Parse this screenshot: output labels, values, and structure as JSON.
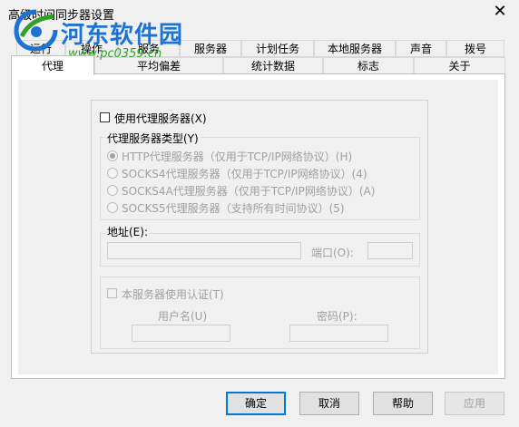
{
  "window": {
    "title": "高级时间同步器设置",
    "close_label": "✕"
  },
  "watermark": {
    "name": "河东软件园",
    "url": "www.pc0359.cn"
  },
  "tabs_row1": [
    {
      "label": "运行"
    },
    {
      "label": "操作"
    },
    {
      "label": "服务"
    },
    {
      "label": "服务器"
    },
    {
      "label": "计划任务"
    },
    {
      "label": "本地服务器"
    },
    {
      "label": "声音"
    },
    {
      "label": "拨号"
    }
  ],
  "tabs_row2": [
    {
      "label": "代理"
    },
    {
      "label": "平均偏差"
    },
    {
      "label": "统计数据"
    },
    {
      "label": "标志"
    },
    {
      "label": "关于"
    }
  ],
  "proxy": {
    "use_proxy_label": "使用代理服务器(X)",
    "use_proxy_checked": false,
    "type_group_label": "代理服务器类型(Y)",
    "types": [
      {
        "label": "HTTP代理服务器（仅用于TCP/IP网络协议）(H)",
        "checked": true
      },
      {
        "label": "SOCKS4代理服务器（仅用于TCP/IP网络协议）(4)",
        "checked": false
      },
      {
        "label": "SOCKS4A代理服务器（仅用于TCP/IP网络协议）(A)",
        "checked": false
      },
      {
        "label": "SOCKS5代理服务器（支持所有时间协议）(5)",
        "checked": false
      }
    ],
    "address_label": "地址(E):",
    "address_value": "",
    "port_label": "端口(O):",
    "port_value": "",
    "auth_label": "本服务器使用认证(T)",
    "auth_checked": false,
    "username_label": "用户名(U)",
    "username_value": "",
    "password_label": "密码(P):",
    "password_value": ""
  },
  "buttons": {
    "ok": "确定",
    "cancel": "取消",
    "help": "帮助",
    "apply": "应用"
  }
}
